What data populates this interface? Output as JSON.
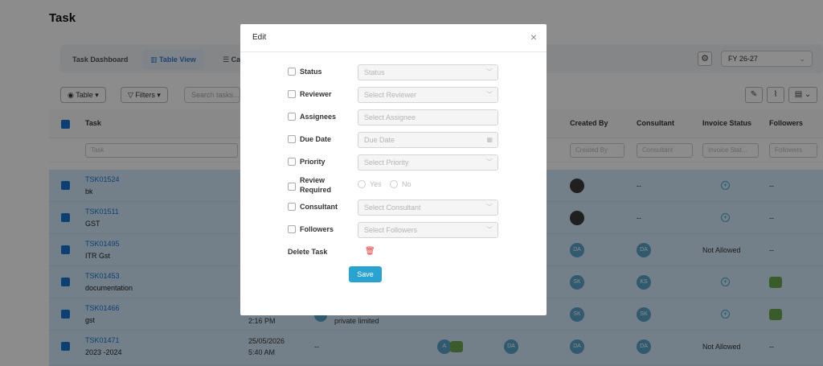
{
  "page": {
    "title": "Task"
  },
  "viewbar": {
    "tabs": [
      {
        "label": "Task Dashboard"
      },
      {
        "label": "Table View"
      },
      {
        "label": "Ca"
      }
    ],
    "fy": "FY 26-27"
  },
  "toolbar": {
    "table_label": "Table",
    "filters_label": "Filters",
    "search_placeholder": "Search tasks..."
  },
  "table": {
    "headers": {
      "task": "Task",
      "created_by": "Created By",
      "consultant": "Consultant",
      "invoice_status": "Invoice Status",
      "followers": "Followers"
    },
    "filters": {
      "task": "Task",
      "created_by": "Created By",
      "consultant": "Consultant",
      "invoice": "Invoice Stat...",
      "followers": "Followers"
    },
    "rows": [
      {
        "id": "TSK01524",
        "name": "bk",
        "col_a": "",
        "col_b": "",
        "created_by": "",
        "consultant": "--",
        "invoice": "",
        "followers": "--"
      },
      {
        "id": "TSK01511",
        "name": "GST",
        "col_a": "",
        "col_b": "",
        "created_by": "",
        "consultant": "--",
        "invoice": "",
        "followers": "--"
      },
      {
        "id": "TSK01495",
        "name": "ITR Gst",
        "col_a": "",
        "col_b": "",
        "created_by": "DA",
        "consultant": "DA",
        "invoice": "Not Allowed",
        "followers": "--"
      },
      {
        "id": "TSK01453",
        "name": "documentation",
        "col_a": "",
        "col_b": "",
        "created_by": "SK",
        "consultant": "KS",
        "invoice": "",
        "followers": ""
      },
      {
        "id": "TSK01466",
        "name": "gst",
        "col_a": "2:16 PM",
        "col_b": "private limited",
        "created_by": "SK",
        "consultant": "SK",
        "invoice": "",
        "followers": ""
      },
      {
        "id": "TSK01471",
        "name": "2023 -2024",
        "col_a": "25/05/2026",
        "col_a2": "5:40 AM",
        "col_b": "--",
        "assign": "A",
        "other": "DA",
        "created_by": "DA",
        "consultant": "DA",
        "invoice": "Not Allowed",
        "followers": "--"
      }
    ]
  },
  "modal": {
    "title": "Edit",
    "close_icon": "×",
    "fields": [
      {
        "label": "Status",
        "placeholder": "Status"
      },
      {
        "label": "Reviewer",
        "placeholder": "Select Reviewer"
      },
      {
        "label": "Assignees",
        "placeholder": "Select Assignee"
      },
      {
        "label": "Due Date",
        "placeholder": "Due Date"
      },
      {
        "label": "Priority",
        "placeholder": "Select Priority"
      },
      {
        "label": "Review Required",
        "yes": "Yes",
        "no": "No"
      },
      {
        "label": "Consultant",
        "placeholder": "Select Consultant"
      },
      {
        "label": "Followers",
        "placeholder": "Select Followers"
      }
    ],
    "delete_label": "Delete Task",
    "save_label": "Save"
  },
  "colors": {
    "accent": "#1a73d0",
    "save": "#2aa3d2",
    "delete": "#e53935",
    "row_selected": "#d3eafa"
  }
}
